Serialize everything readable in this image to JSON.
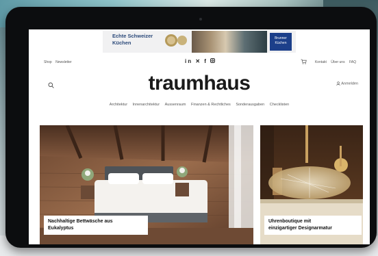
{
  "ad": {
    "headline_line1": "Echte Schweizer",
    "headline_line2": "Küchen",
    "brand_line1": "Brunner",
    "brand_line2": "Küchen"
  },
  "header": {
    "util_left": [
      "Shop",
      "Newsletter"
    ],
    "social": [
      "in",
      "X",
      "f",
      "ig"
    ],
    "util_right": [
      "Kontakt",
      "Über uns",
      "FAQ"
    ],
    "logo": "traumhaus",
    "login": "Anmelden"
  },
  "nav": [
    "Architektur",
    "Innenarchitektur",
    "Aussenraum",
    "Finanzen & Rechtliches",
    "Sonderausgaben",
    "Checklisten"
  ],
  "cards": [
    {
      "caption_line1": "Nachhaltige Bettwäsche aus",
      "caption_line2": "Eukalyptus"
    },
    {
      "caption_line1": "Uhrenboutique mit",
      "caption_line2": "einzigartiger Designarmatur"
    }
  ],
  "colors": {
    "brand_blue": "#1c3f8a",
    "ad_text": "#2c4a7a",
    "wood": "#7a5238"
  }
}
